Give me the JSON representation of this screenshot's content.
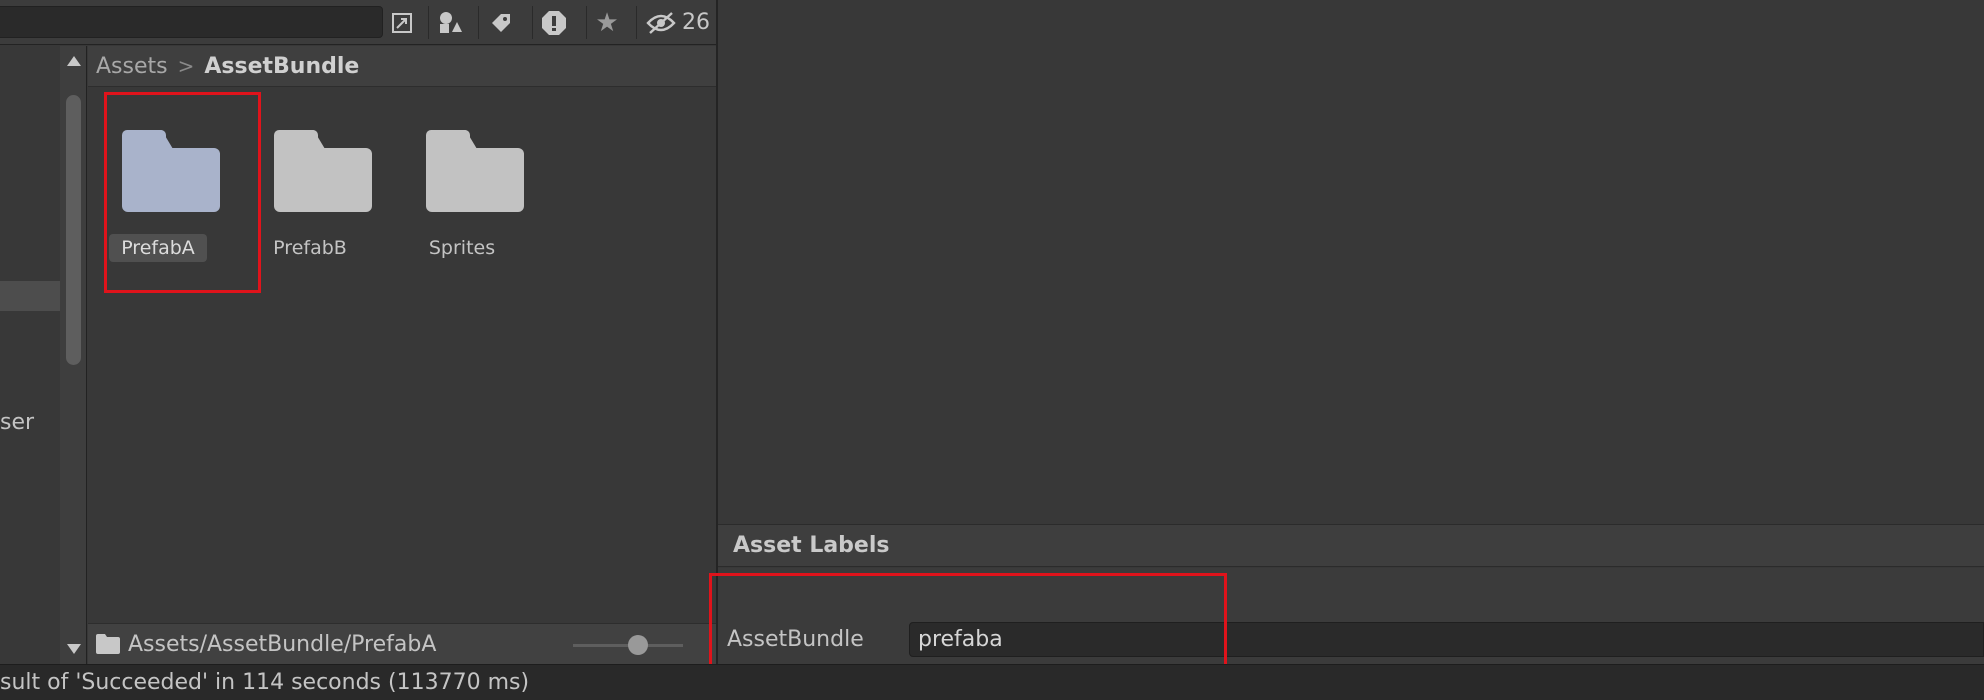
{
  "project": {
    "search": {
      "placeholder": ""
    },
    "toolbar": {
      "hidden_count": "26"
    },
    "tree": {
      "partial_item": "ser"
    },
    "breadcrumb": {
      "root": "Assets",
      "separator": ">",
      "current": "AssetBundle"
    },
    "items": [
      {
        "name": "PrefabA",
        "selected": true
      },
      {
        "name": "PrefabB",
        "selected": false
      },
      {
        "name": "Sprites",
        "selected": false
      }
    ],
    "footer": {
      "path": "Assets/AssetBundle/PrefabA"
    },
    "icon_size_slider": {
      "value_fraction": 0.5
    }
  },
  "inspector": {
    "section_title": "Asset Labels",
    "assetbundle_label": "AssetBundle",
    "assetbundle_value": "prefaba"
  },
  "statusbar": {
    "message": "sult of 'Succeeded' in 114 seconds (113770 ms)"
  },
  "colors": {
    "highlight": "#e0131b",
    "selected_folder": "#a9b3cb",
    "folder": "#c2c2c2"
  }
}
